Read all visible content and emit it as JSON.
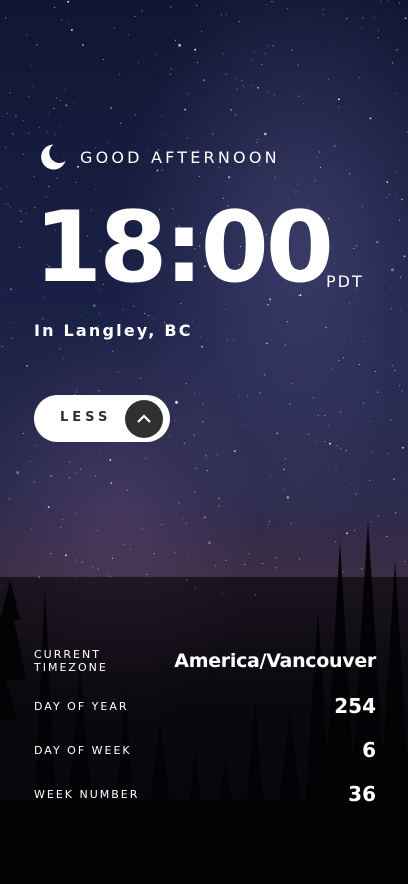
{
  "header": {
    "greeting": "GOOD AFTERNOON",
    "greeting_icon": "moon-icon"
  },
  "clock": {
    "time": "18:00",
    "timezone_abbr": "PDT",
    "location": "In Langley, BC"
  },
  "toggle": {
    "label": "LESS",
    "icon": "chevron-up-icon"
  },
  "details": {
    "current_timezone_label_line1": "CURRENT",
    "current_timezone_label_line2": "TIMEZONE",
    "current_timezone_value": "America/Vancouver",
    "day_of_year_label": "DAY OF YEAR",
    "day_of_year_value": "254",
    "day_of_week_label": "DAY OF WEEK",
    "day_of_week_value": "6",
    "week_number_label": "WEEK NUMBER",
    "week_number_value": "36"
  },
  "colors": {
    "button_bg": "#ffffff",
    "button_text": "#303030",
    "arrow_circle": "#303030",
    "overlay": "rgba(0,0,0,0.55)"
  }
}
